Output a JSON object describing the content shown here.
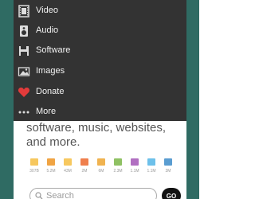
{
  "menu": {
    "items": [
      {
        "label": "Video",
        "icon": "film-icon"
      },
      {
        "label": "Audio",
        "icon": "speaker-icon"
      },
      {
        "label": "Software",
        "icon": "floppy-disk-icon"
      },
      {
        "label": "Images",
        "icon": "image-icon"
      },
      {
        "label": "Donate",
        "icon": "heart-icon"
      },
      {
        "label": "More",
        "icon": "more-dots-icon"
      }
    ]
  },
  "hero": {
    "line1": "software, music, websites,",
    "line2": "and more."
  },
  "media_counts": [
    {
      "icon": "web-icon",
      "count": "307B",
      "color": "#f6c75e"
    },
    {
      "icon": "film-icon",
      "count": "5.2M",
      "color": "#f0a443"
    },
    {
      "icon": "book-icon",
      "count": "43M",
      "color": "#f7c85f"
    },
    {
      "icon": "tv-icon",
      "count": "2M",
      "color": "#ef7f4d"
    },
    {
      "icon": "video-icon",
      "count": "6M",
      "color": "#f0b350"
    },
    {
      "icon": "software-icon",
      "count": "2.3M",
      "color": "#8fc163"
    },
    {
      "icon": "images-icon",
      "count": "1.1M",
      "color": "#b16fc1"
    },
    {
      "icon": "microphone-icon",
      "count": "1.1M",
      "color": "#6dc0ea"
    },
    {
      "icon": "list-icon",
      "count": "3M",
      "color": "#5a9dd1"
    }
  ],
  "search": {
    "placeholder": "Search",
    "go_label": "GO"
  },
  "colors": {
    "accent_strip": "#2f6b63",
    "menu_bg": "#333333",
    "donate_heart": "#e23b3b"
  }
}
